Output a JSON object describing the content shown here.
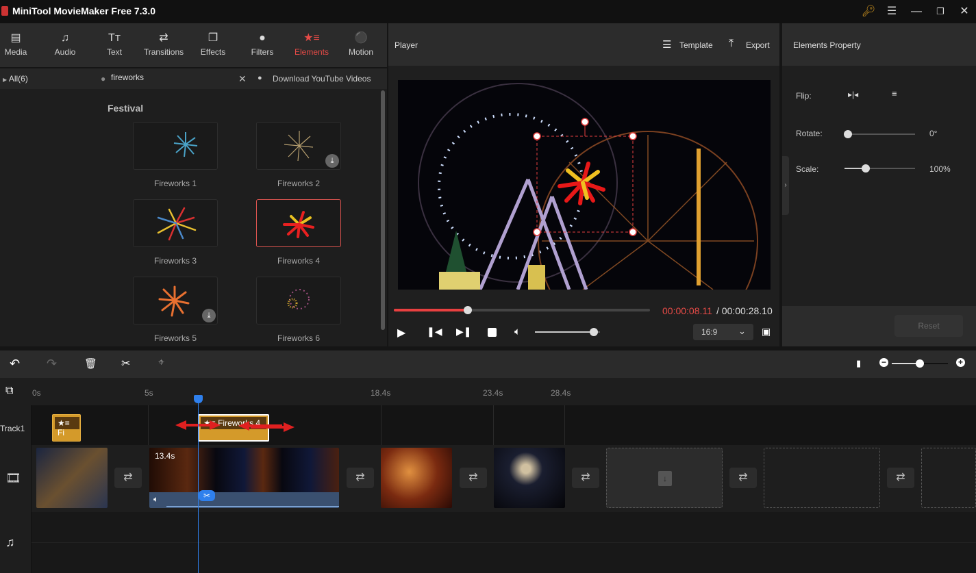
{
  "app": {
    "title": "MiniTool MovieMaker Free 7.3.0"
  },
  "window_controls": [
    "key-icon",
    "menu-icon",
    "minimize-icon",
    "maximize-icon",
    "close-icon"
  ],
  "toolbar": {
    "tabs": [
      {
        "label": "Media",
        "icon": "folder-icon"
      },
      {
        "label": "Audio",
        "icon": "music-icon"
      },
      {
        "label": "Text",
        "icon": "text-icon"
      },
      {
        "label": "Transitions",
        "icon": "swap-icon"
      },
      {
        "label": "Effects",
        "icon": "effects-icon"
      },
      {
        "label": "Filters",
        "icon": "filters-icon"
      },
      {
        "label": "Elements",
        "icon": "elements-icon",
        "active": true
      },
      {
        "label": "Motion",
        "icon": "motion-icon"
      }
    ]
  },
  "library": {
    "category": "All(6)",
    "search_value": "fireworks",
    "download_youtube": "Download YouTube Videos",
    "section_title": "Festival",
    "items": [
      {
        "label": "Fireworks 1",
        "download": false,
        "selected": false
      },
      {
        "label": "Fireworks 2",
        "download": true,
        "selected": false
      },
      {
        "label": "Fireworks 3",
        "download": false,
        "selected": false
      },
      {
        "label": "Fireworks 4",
        "download": false,
        "selected": true
      },
      {
        "label": "Fireworks 5",
        "download": true,
        "selected": false
      },
      {
        "label": "Fireworks 6",
        "download": false,
        "selected": false
      }
    ]
  },
  "player": {
    "title": "Player",
    "template_label": "Template",
    "export_label": "Export",
    "current_time": "00:00:08.11",
    "total_time": "/ 00:00:28.10",
    "progress": 0.29,
    "volume": 0.9,
    "aspect_ratio": "16:9"
  },
  "properties": {
    "title": "Elements Property",
    "flip_label": "Flip:",
    "rotate_label": "Rotate:",
    "rotate_value": "0°",
    "rotate_fraction": 0.0,
    "scale_label": "Scale:",
    "scale_value": "100%",
    "scale_fraction": 0.3,
    "reset_label": "Reset"
  },
  "timeline": {
    "zoom_fraction": 0.5,
    "ticks": [
      {
        "label": "0s"
      },
      {
        "label": "5s"
      },
      {
        "label": "18.4s"
      },
      {
        "label": "23.4s"
      },
      {
        "label": "28.4s"
      }
    ],
    "track1_label": "Track1",
    "element_clips": [
      {
        "label": "Fi"
      },
      {
        "label": "Fireworks 4"
      }
    ],
    "video_clip_duration": "13.4s"
  }
}
